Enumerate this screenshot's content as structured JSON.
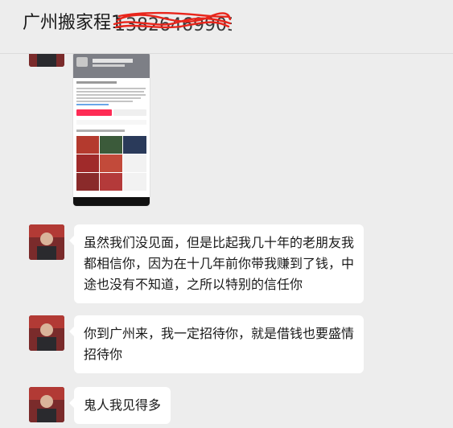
{
  "header": {
    "title": "广州搬家程1"
  },
  "messages": [
    {
      "type": "image",
      "caption_lines": []
    },
    {
      "type": "text",
      "lines": [
        "虽然我们没见面，但是比起我几十年的老朋友我",
        "都相信你，因为在十几年前你带我赚到了钱，中",
        "途也没有不知道，之所以特别的信任你"
      ]
    },
    {
      "type": "text",
      "lines": [
        "你到广州来，我一定招待你，就是借钱也要盛情",
        "招待你"
      ]
    },
    {
      "type": "text",
      "lines": [
        "鬼人我见得多"
      ]
    }
  ],
  "colors": {
    "background": "#ededed",
    "bubble": "#ffffff",
    "redaction": "#e8251b",
    "accent_pink": "#fe2c55"
  },
  "icons": [
    "avatar",
    "screenshot-thumbnail"
  ]
}
